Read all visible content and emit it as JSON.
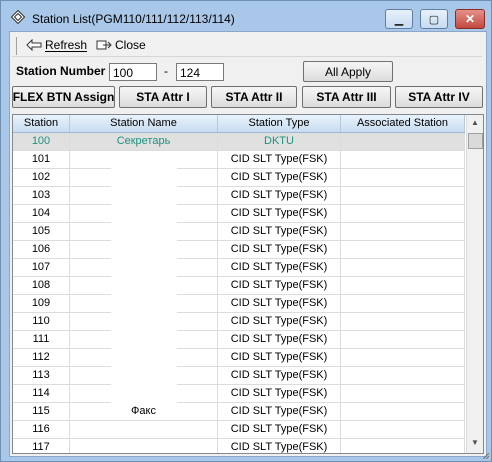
{
  "window": {
    "title": "Station List(PGM110/111/112/113/114)",
    "buttons": {
      "minimize": "▭",
      "maximize": "▢",
      "close": "✕"
    }
  },
  "toolbar": {
    "refresh_label": "Refresh",
    "close_label": "Close"
  },
  "filter": {
    "station_number_label": "Station Number",
    "from_value": "100",
    "separator": "-",
    "to_value": "124",
    "all_apply_label": "All Apply"
  },
  "actions": {
    "flex_btn_assign": "FLEX BTN Assign",
    "sta_attr_1": "STA Attr I",
    "sta_attr_2": "STA Attr II",
    "sta_attr_3": "STA Attr III",
    "sta_attr_4": "STA Attr IV"
  },
  "table": {
    "columns": [
      "Station",
      "Station Name",
      "Station Type",
      "Associated Station"
    ],
    "rows": [
      {
        "station": "100",
        "name": "Секретарь",
        "type": "DKTU",
        "assoc": ""
      },
      {
        "station": "101",
        "name": "",
        "type": "CID SLT Type(FSK)",
        "assoc": ""
      },
      {
        "station": "102",
        "name": "",
        "type": "CID SLT Type(FSK)",
        "assoc": ""
      },
      {
        "station": "103",
        "name": "",
        "type": "CID SLT Type(FSK)",
        "assoc": ""
      },
      {
        "station": "104",
        "name": "",
        "type": "CID SLT Type(FSK)",
        "assoc": ""
      },
      {
        "station": "105",
        "name": "",
        "type": "CID SLT Type(FSK)",
        "assoc": ""
      },
      {
        "station": "106",
        "name": "",
        "type": "CID SLT Type(FSK)",
        "assoc": ""
      },
      {
        "station": "107",
        "name": "",
        "type": "CID SLT Type(FSK)",
        "assoc": ""
      },
      {
        "station": "108",
        "name": "",
        "type": "CID SLT Type(FSK)",
        "assoc": ""
      },
      {
        "station": "109",
        "name": "",
        "type": "CID SLT Type(FSK)",
        "assoc": ""
      },
      {
        "station": "110",
        "name": "",
        "type": "CID SLT Type(FSK)",
        "assoc": ""
      },
      {
        "station": "111",
        "name": "",
        "type": "CID SLT Type(FSK)",
        "assoc": ""
      },
      {
        "station": "112",
        "name": "",
        "type": "CID SLT Type(FSK)",
        "assoc": ""
      },
      {
        "station": "113",
        "name": "",
        "type": "CID SLT Type(FSK)",
        "assoc": ""
      },
      {
        "station": "114",
        "name": "",
        "type": "CID SLT Type(FSK)",
        "assoc": ""
      },
      {
        "station": "115",
        "name": "Факс",
        "type": "CID SLT Type(FSK)",
        "assoc": ""
      },
      {
        "station": "116",
        "name": "",
        "type": "CID SLT Type(FSK)",
        "assoc": ""
      },
      {
        "station": "117",
        "name": "",
        "type": "CID SLT Type(FSK)",
        "assoc": ""
      }
    ]
  },
  "colors": {
    "selected_text": "#1e9080",
    "selected_row": "#e0e0e0",
    "frame": "#a9c7e8"
  },
  "icons": {
    "app": "diamond-app-icon",
    "refresh": "refresh-arrow-icon",
    "close": "close-doc-icon"
  }
}
